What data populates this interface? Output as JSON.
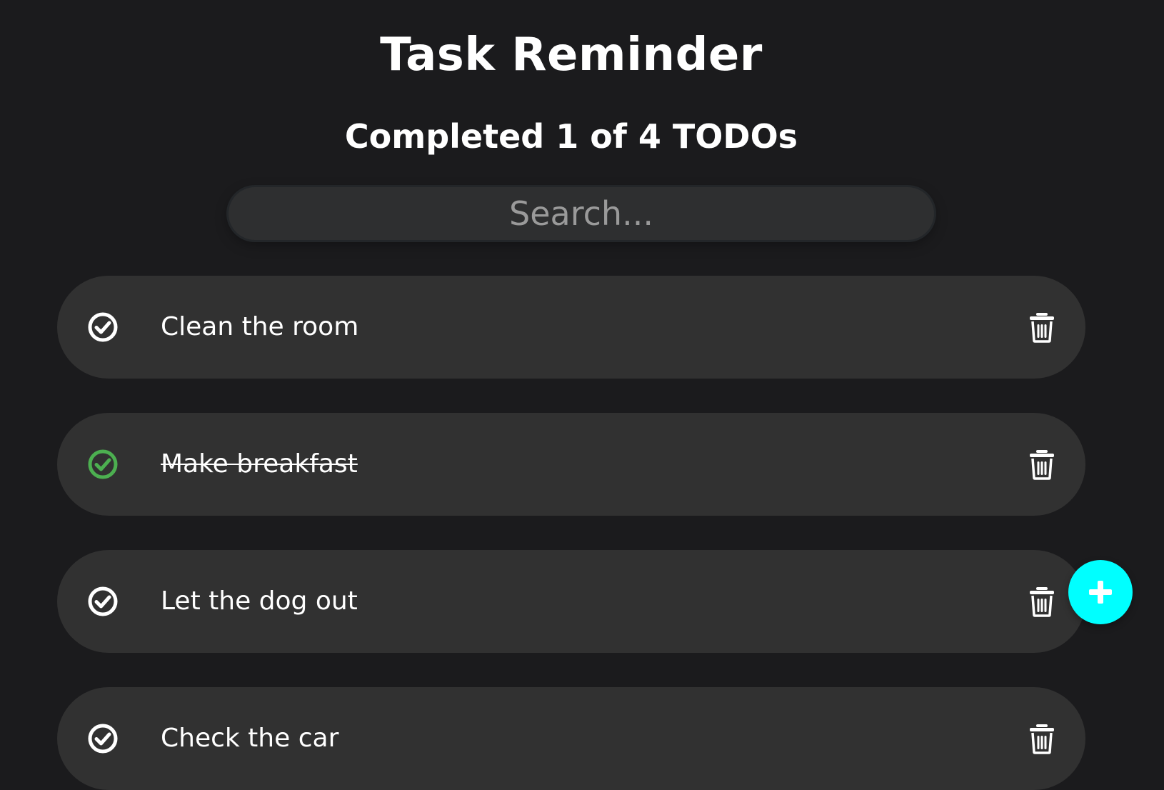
{
  "header": {
    "title": "Task Reminder",
    "subtitle": "Completed 1 of 4 TODOs"
  },
  "search": {
    "placeholder": "Search..."
  },
  "colors": {
    "background": "#1b1b1d",
    "item_background": "#313131",
    "check_default": "#ffffff",
    "check_done": "#4caf50",
    "fab": "#00ffff"
  },
  "todos": [
    {
      "text": "Clean the room",
      "completed": false,
      "check_icon": "check-circle-icon",
      "delete_icon": "trash-icon"
    },
    {
      "text": "Make breakfast",
      "completed": true,
      "check_icon": "check-circle-icon",
      "delete_icon": "trash-icon"
    },
    {
      "text": "Let the dog out",
      "completed": false,
      "check_icon": "check-circle-icon",
      "delete_icon": "trash-icon"
    },
    {
      "text": "Check the car",
      "completed": false,
      "check_icon": "check-circle-icon",
      "delete_icon": "trash-icon"
    }
  ],
  "fab": {
    "icon": "plus-icon"
  }
}
